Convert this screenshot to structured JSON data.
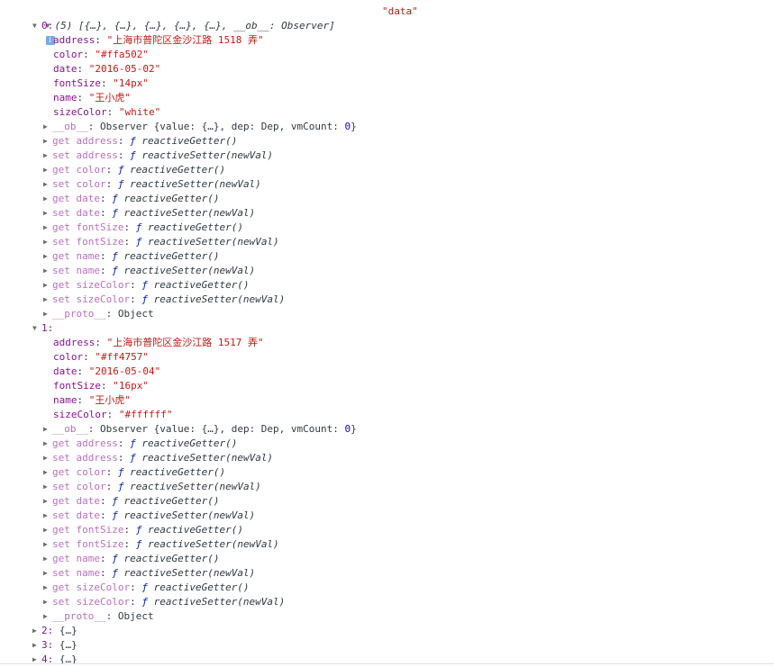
{
  "header": {
    "summary": "(5) [{…}, {…}, {…}, {…}, {…}, __ob__: Observer]",
    "info_icon": "i",
    "label": "\"data\""
  },
  "items": [
    {
      "index": "0:",
      "props": [
        {
          "key": "address",
          "value": "\"上海市普陀区金沙江路 1518 弄\""
        },
        {
          "key": "color",
          "value": "\"#ffa502\""
        },
        {
          "key": "date",
          "value": "\"2016-05-02\""
        },
        {
          "key": "fontSize",
          "value": "\"14px\""
        },
        {
          "key": "name",
          "value": "\"王小虎\""
        },
        {
          "key": "sizeColor",
          "value": "\"white\""
        }
      ]
    },
    {
      "index": "1:",
      "props": [
        {
          "key": "address",
          "value": "\"上海市普陀区金沙江路 1517 弄\""
        },
        {
          "key": "color",
          "value": "\"#ff4757\""
        },
        {
          "key": "date",
          "value": "\"2016-05-04\""
        },
        {
          "key": "fontSize",
          "value": "\"16px\""
        },
        {
          "key": "name",
          "value": "\"王小虎\""
        },
        {
          "key": "sizeColor",
          "value": "\"#ffffff\""
        }
      ]
    }
  ],
  "observer": {
    "key": "__ob__",
    "text_a": "Observer {value: {…}, dep: Dep, vmCount: ",
    "count": "0",
    "text_b": "}"
  },
  "accessors": [
    {
      "label": "get address",
      "fn": "reactiveGetter()"
    },
    {
      "label": "set address",
      "fn": "reactiveSetter(newVal)"
    },
    {
      "label": "get color",
      "fn": "reactiveGetter()"
    },
    {
      "label": "set color",
      "fn": "reactiveSetter(newVal)"
    },
    {
      "label": "get date",
      "fn": "reactiveGetter()"
    },
    {
      "label": "set date",
      "fn": "reactiveSetter(newVal)"
    },
    {
      "label": "get fontSize",
      "fn": "reactiveGetter()"
    },
    {
      "label": "set fontSize",
      "fn": "reactiveSetter(newVal)"
    },
    {
      "label": "get name",
      "fn": "reactiveGetter()"
    },
    {
      "label": "set name",
      "fn": "reactiveSetter(newVal)"
    },
    {
      "label": "get sizeColor",
      "fn": "reactiveGetter()"
    },
    {
      "label": "set sizeColor",
      "fn": "reactiveSetter(newVal)"
    }
  ],
  "fn_symbol": "ƒ",
  "proto": {
    "key": "__proto__",
    "value": "Object"
  },
  "collapsed": [
    {
      "index": "2:",
      "value": "{…}"
    },
    {
      "index": "3:",
      "value": "{…}"
    },
    {
      "index": "4:",
      "value": "{…}"
    }
  ],
  "colors": {
    "key": "#881391",
    "accessor_key": "#b871bf",
    "string": "#c41a16",
    "number": "#1c00cf",
    "function": "#0d22aa",
    "text": "#303942"
  }
}
